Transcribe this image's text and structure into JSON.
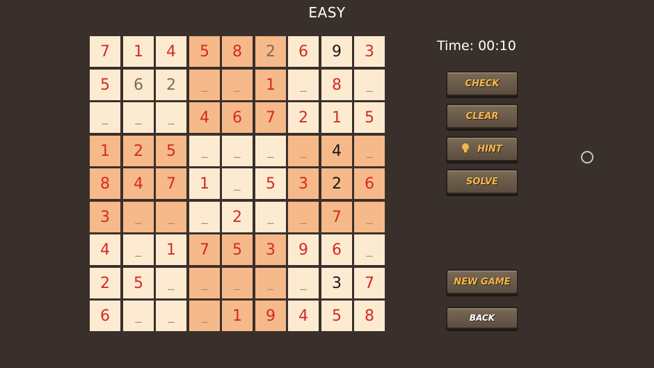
{
  "title": "EASY",
  "timer": "Time: 00:10",
  "buttons": {
    "check": "CHECK",
    "clear": "CLEAR",
    "hint": "HINT",
    "solve": "SOLVE",
    "new_game": "NEW GAME",
    "back": "BACK"
  },
  "colors": {
    "background": "#3a302b",
    "cell_light": "#fdebd1",
    "cell_dark": "#f6b98a",
    "given_digit": "#d42a22",
    "entered_digit": "#1c1613",
    "hint_digit": "#7d6a5f",
    "button_text": "#f3b64a"
  },
  "board": [
    [
      "7",
      "1",
      "4",
      "5",
      "8",
      "2",
      "6",
      "9",
      "3"
    ],
    [
      "5",
      "6",
      "2",
      "_",
      "_",
      "1",
      "_",
      "8",
      "_"
    ],
    [
      "_",
      "_",
      "_",
      "4",
      "6",
      "7",
      "2",
      "1",
      "5"
    ],
    [
      "1",
      "2",
      "5",
      "_",
      "_",
      "_",
      "_",
      "4",
      "_"
    ],
    [
      "8",
      "4",
      "7",
      "1",
      "_",
      "5",
      "3",
      "2",
      "6"
    ],
    [
      "3",
      "_",
      "_",
      "_",
      "2",
      "_",
      "_",
      "7",
      "_"
    ],
    [
      "4",
      "_",
      "1",
      "7",
      "5",
      "3",
      "9",
      "6",
      "_"
    ],
    [
      "2",
      "5",
      "_",
      "_",
      "_",
      "_",
      "_",
      "3",
      "7"
    ],
    [
      "6",
      "_",
      "_",
      "_",
      "1",
      "9",
      "4",
      "5",
      "8"
    ]
  ],
  "digit_styles": [
    [
      "r",
      "r",
      "r",
      "r",
      "r",
      "g",
      "r",
      "k",
      "r"
    ],
    [
      "r",
      "g",
      "g",
      "e",
      "e",
      "r",
      "e",
      "r",
      "e"
    ],
    [
      "e",
      "e",
      "e",
      "r",
      "r",
      "r",
      "r",
      "r",
      "r"
    ],
    [
      "r",
      "r",
      "r",
      "e",
      "e",
      "e",
      "e",
      "k",
      "e"
    ],
    [
      "r",
      "r",
      "r",
      "r",
      "e",
      "r",
      "r",
      "k",
      "r"
    ],
    [
      "r",
      "e",
      "e",
      "e",
      "r",
      "e",
      "e",
      "r",
      "e"
    ],
    [
      "r",
      "e",
      "r",
      "r",
      "r",
      "r",
      "r",
      "r",
      "e"
    ],
    [
      "r",
      "r",
      "e",
      "e",
      "e",
      "e",
      "e",
      "k",
      "r"
    ],
    [
      "r",
      "e",
      "e",
      "e",
      "r",
      "r",
      "r",
      "r",
      "r"
    ]
  ]
}
